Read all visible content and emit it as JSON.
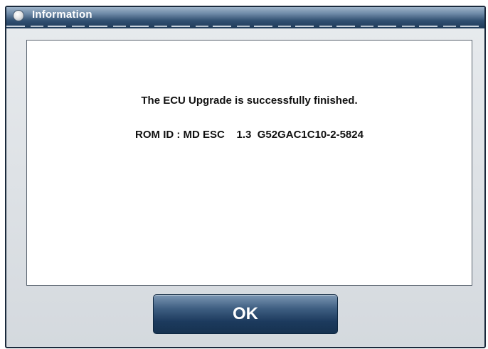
{
  "window": {
    "title": "Information"
  },
  "message": {
    "line1": "The ECU Upgrade is successfully finished.",
    "line2": "ROM ID : MD ESC    1.3  G52GAC1C10-2-5824"
  },
  "buttons": {
    "ok_label": "OK"
  },
  "colors": {
    "titlebar": "#2f4e70",
    "button": "#1c3a5d",
    "panel_bg": "#ffffff",
    "window_bg": "#dde1e5"
  },
  "icons": {
    "title_icon": "info-circle-icon"
  }
}
